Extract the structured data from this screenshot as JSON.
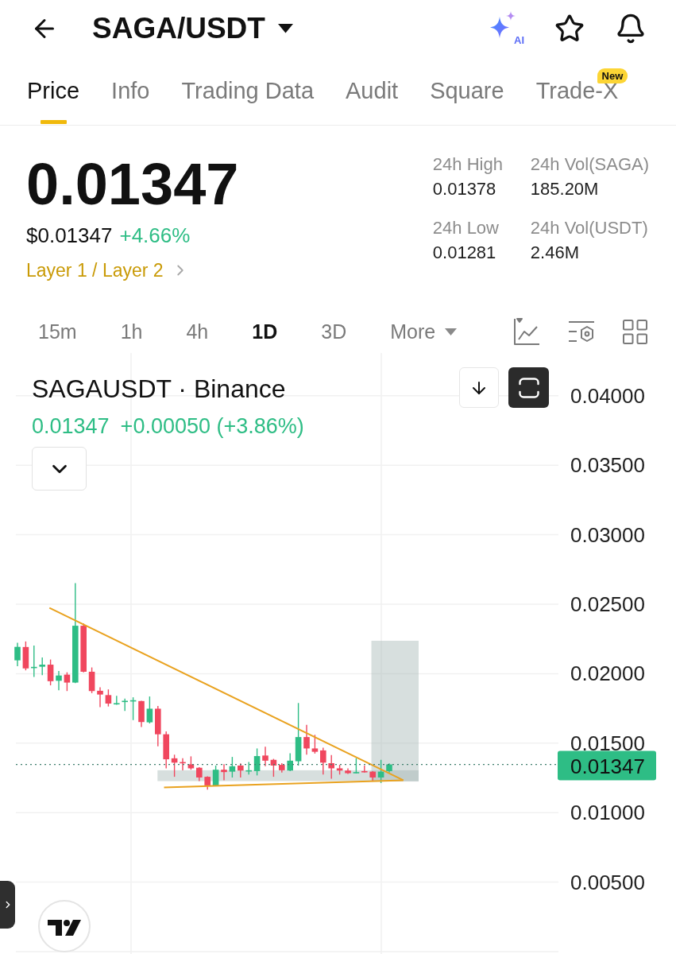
{
  "header": {
    "title": "SAGA/USDT",
    "ai_label": "AI"
  },
  "tabs": [
    {
      "label": "Price",
      "selected": true
    },
    {
      "label": "Info",
      "selected": false
    },
    {
      "label": "Trading Data",
      "selected": false
    },
    {
      "label": "Audit",
      "selected": false
    },
    {
      "label": "Square",
      "selected": false
    },
    {
      "label": "Trade-X",
      "selected": false,
      "badge": "New"
    }
  ],
  "ticker": {
    "price": "0.01347",
    "usd_price": "$0.01347",
    "change": "+4.66%",
    "category": "Layer 1 / Layer 2",
    "stats": [
      {
        "label": "24h High",
        "value": "0.01378"
      },
      {
        "label": "24h Vol(SAGA)",
        "value": "185.20M"
      },
      {
        "label": "24h Low",
        "value": "0.01281"
      },
      {
        "label": "24h Vol(USDT)",
        "value": "2.46M"
      }
    ]
  },
  "intervals": [
    {
      "label": "15m",
      "selected": false,
      "kind": "interval"
    },
    {
      "label": "1h",
      "selected": false,
      "kind": "interval"
    },
    {
      "label": "4h",
      "selected": false,
      "kind": "interval"
    },
    {
      "label": "1D",
      "selected": true,
      "kind": "interval"
    },
    {
      "label": "3D",
      "selected": false,
      "kind": "interval"
    },
    {
      "label": "More",
      "selected": false,
      "kind": "menu"
    }
  ],
  "chart": {
    "symbol": "SAGAUSDT · Binance",
    "last_price": "0.01347",
    "change": "+0.00050 (+3.86%)",
    "price_label": "0.01347",
    "y_axis": [
      "0.04000",
      "0.03500",
      "0.03000",
      "0.02500",
      "0.02000",
      "0.01500",
      "0.01000",
      "0.00500"
    ]
  }
}
